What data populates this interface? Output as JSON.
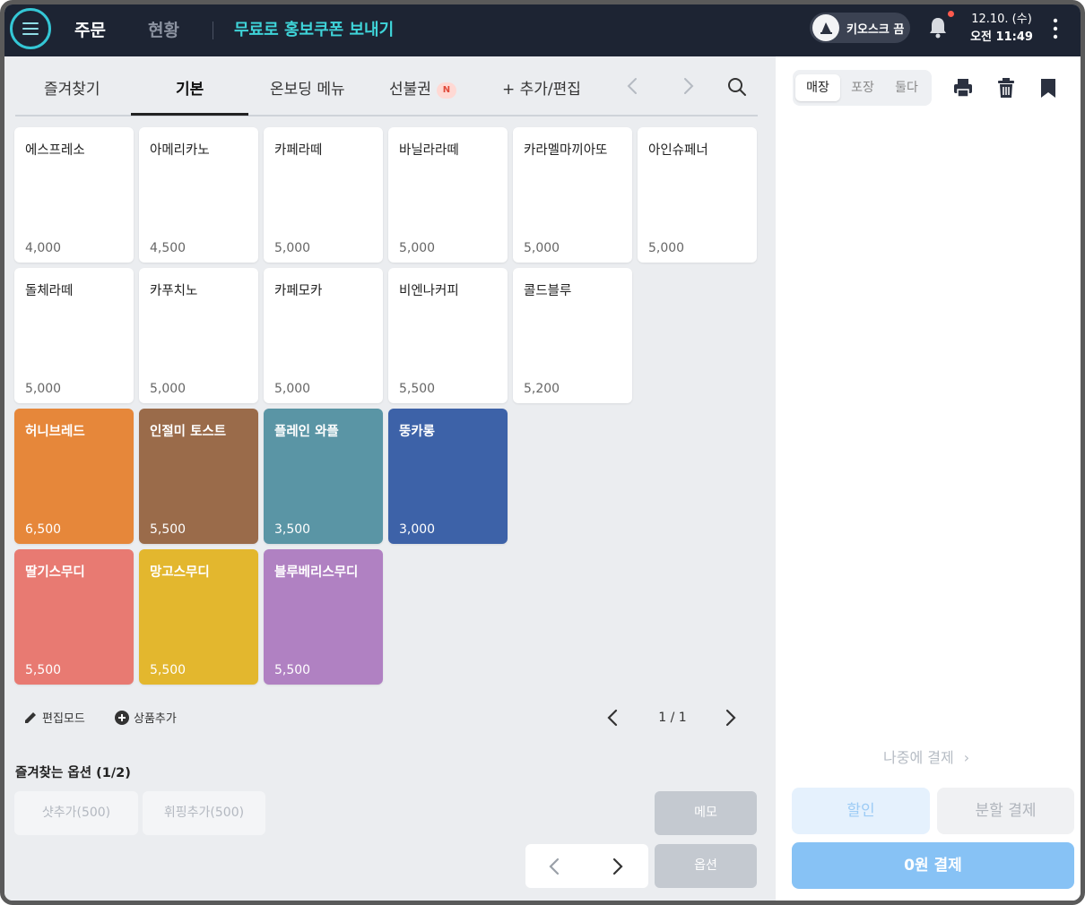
{
  "topbar": {
    "tab_order": "주문",
    "tab_status": "현황",
    "promo": "무료로 홍보쿠폰 보내기",
    "kiosk_label": "키오스크 끔",
    "date": "12.10. (수)",
    "time": "오전 11:49",
    "notification_dot_color": "#ff5a4e"
  },
  "categories": {
    "tabs": [
      {
        "label": "즐겨찾기"
      },
      {
        "label": "기본",
        "active": true
      },
      {
        "label": "온보딩 메뉴"
      },
      {
        "label": "선불권",
        "badge": "N"
      },
      {
        "label": "+ 추가/편집"
      }
    ]
  },
  "products": [
    {
      "name": "에스프레소",
      "price": "4,000"
    },
    {
      "name": "아메리카노",
      "price": "4,500"
    },
    {
      "name": "카페라떼",
      "price": "5,000"
    },
    {
      "name": "바닐라라떼",
      "price": "5,000"
    },
    {
      "name": "카라멜마끼아또",
      "price": "5,000"
    },
    {
      "name": "아인슈페너",
      "price": "5,000"
    },
    {
      "name": "돌체라떼",
      "price": "5,000"
    },
    {
      "name": "카푸치노",
      "price": "5,000"
    },
    {
      "name": "카페모카",
      "price": "5,000"
    },
    {
      "name": "비엔나커피",
      "price": "5,500"
    },
    {
      "name": "콜드블루",
      "price": "5,200"
    },
    {
      "name": "허니브레드",
      "price": "6,500",
      "color": "#e6873a"
    },
    {
      "name": "인절미 토스트",
      "price": "5,500",
      "color": "#9a6b4a"
    },
    {
      "name": "플레인 와플",
      "price": "3,500",
      "color": "#5a95a5"
    },
    {
      "name": "뚱카롱",
      "price": "3,000",
      "color": "#3d62a8"
    },
    {
      "name": "딸기스무디",
      "price": "5,500",
      "color": "#e87a72"
    },
    {
      "name": "망고스무디",
      "price": "5,500",
      "color": "#e3b72e"
    },
    {
      "name": "블루베리스무디",
      "price": "5,500",
      "color": "#b081c2"
    }
  ],
  "tools": {
    "edit_mode": "편집모드",
    "add_product": "상품추가",
    "page": "1 / 1"
  },
  "favorites": {
    "title": "즐겨찾는 옵션 (1/2)",
    "options": [
      "샷추가(500)",
      "휘핑추가(500)"
    ],
    "memo": "메모",
    "option": "옵션"
  },
  "order_panel": {
    "seg": [
      "매장",
      "포장",
      "둘다"
    ],
    "pay_later": "나중에 결제",
    "discount": "할인",
    "split_pay": "분할 결제",
    "pay": "0원 결제"
  }
}
